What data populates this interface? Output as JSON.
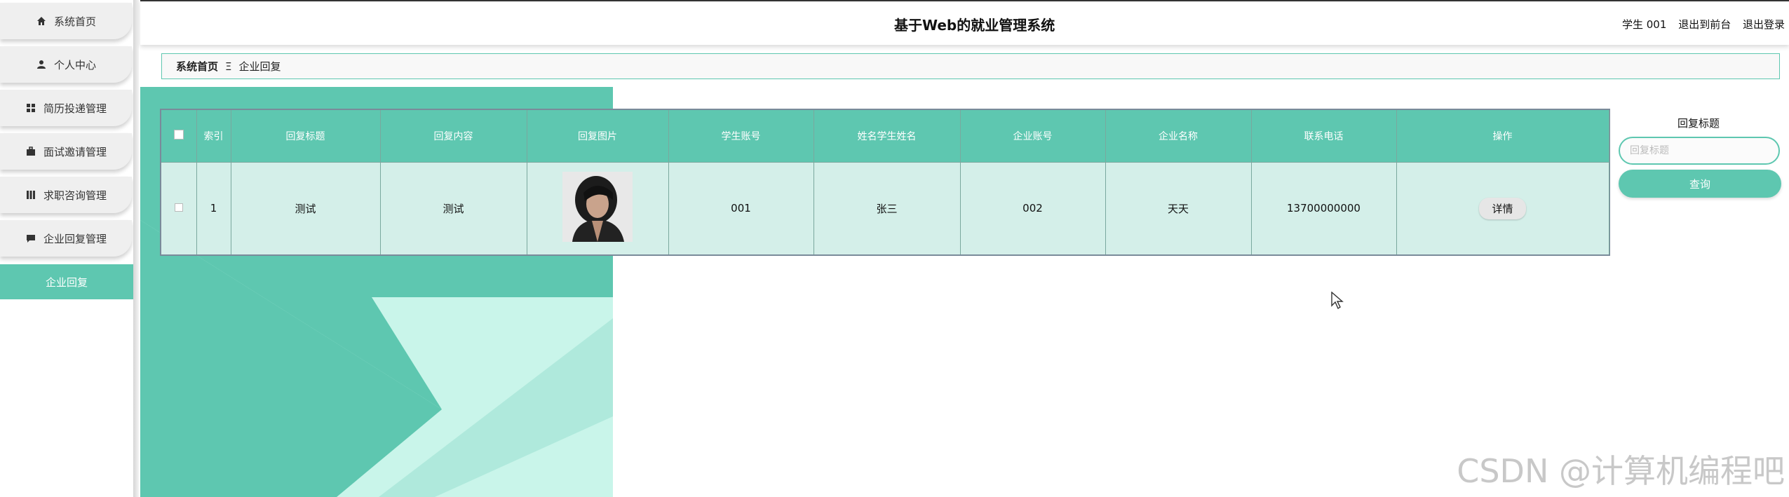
{
  "header": {
    "title": "基于Web的就业管理系统",
    "user": "学生 001",
    "back_link": "退出到前台",
    "logout_link": "退出登录"
  },
  "sidebar": {
    "items": [
      {
        "label": "系统首页",
        "icon": "home-icon"
      },
      {
        "label": "个人中心",
        "icon": "person-icon"
      },
      {
        "label": "简历投递管理",
        "icon": "grid-icon"
      },
      {
        "label": "面试邀请管理",
        "icon": "briefcase-icon"
      },
      {
        "label": "求职咨询管理",
        "icon": "columns-icon"
      },
      {
        "label": "企业回复管理",
        "icon": "chat-icon"
      }
    ],
    "active_sub": "企业回复"
  },
  "breadcrumb": {
    "home": "系统首页",
    "separator": "Ξ",
    "current": "企业回复"
  },
  "table": {
    "headers": [
      "索引",
      "回复标题",
      "回复内容",
      "回复图片",
      "学生账号",
      "姓名学生姓名",
      "企业账号",
      "企业名称",
      "联系电话",
      "操作"
    ],
    "rows": [
      {
        "index": "1",
        "title": "测试",
        "content": "测试",
        "student_account": "001",
        "student_name": "张三",
        "company_account": "002",
        "company_name": "天天",
        "phone": "13700000000",
        "action": "详情"
      }
    ]
  },
  "search": {
    "label": "回复标题",
    "placeholder": "回复标题",
    "button": "查询"
  },
  "watermark": "CSDN @计算机编程吧",
  "colors": {
    "accent": "#5ec7b0",
    "row_bg": "#d4efe9",
    "deco_light": "#c9f5ea"
  }
}
